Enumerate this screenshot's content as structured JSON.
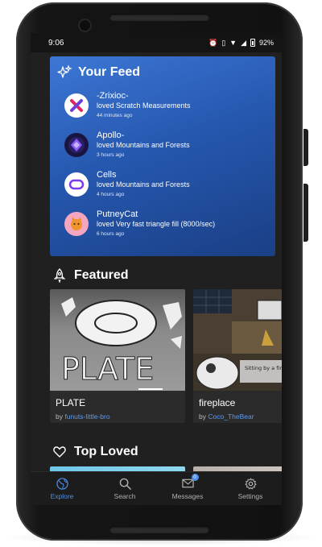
{
  "status": {
    "time": "9:06",
    "battery": "92%"
  },
  "feed": {
    "title": "Your Feed",
    "items": [
      {
        "user": "-Zrixioc-",
        "action": "loved Scratch Measurements",
        "time": "44 minutes ago"
      },
      {
        "user": "Apollo-",
        "action": "loved Mountains and Forests",
        "time": "3 hours ago"
      },
      {
        "user": "Cells",
        "action": "loved Mountains and Forests",
        "time": "4 hours ago"
      },
      {
        "user": "PutneyCat",
        "action": "loved Very fast triangle fill (8000/sec)",
        "time": "6 hours ago"
      }
    ]
  },
  "featured": {
    "title": "Featured",
    "cards": [
      {
        "title": "PLATE",
        "by": "by",
        "author": "funuts-little-bro",
        "thumb_text": "PLATE"
      },
      {
        "title": "fireplace",
        "by": "by",
        "author": "Coco_TheBear",
        "thumb_text": "Sitting by a fireplace while its rain"
      }
    ]
  },
  "top_loved": {
    "title": "Top Loved"
  },
  "nav": {
    "items": [
      {
        "label": "Explore",
        "icon": "globe-icon",
        "active": true
      },
      {
        "label": "Search",
        "icon": "search-icon"
      },
      {
        "label": "Messages",
        "icon": "mail-icon",
        "badge": "0"
      },
      {
        "label": "Settings",
        "icon": "gear-icon"
      }
    ]
  },
  "colors": {
    "accent": "#4d8ee8",
    "feed_top": "#3d77d6",
    "feed_bottom": "#1a3f85",
    "background": "#202020"
  }
}
